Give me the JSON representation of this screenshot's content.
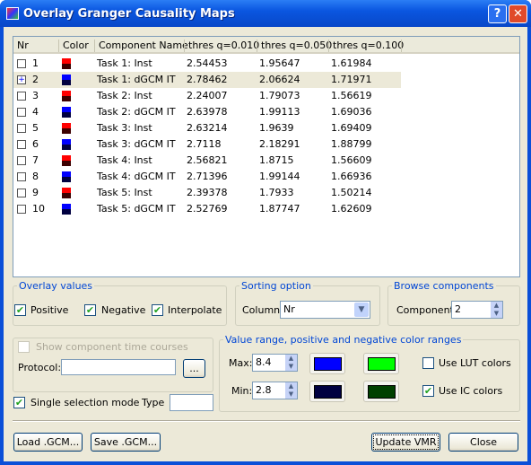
{
  "window": {
    "title": "Overlay Granger Causality Maps",
    "help": "?",
    "close": "✕"
  },
  "table": {
    "headers": [
      "Nr",
      "Color",
      "Component Name",
      "thres q=0.010",
      "thres q=0.050",
      "thres q=0.100"
    ],
    "rows": [
      {
        "nr": "1",
        "name": "Task 1: Inst",
        "t1": "2.54453",
        "t2": "1.95647",
        "t3": "1.61984",
        "type": "inst",
        "expanded": false
      },
      {
        "nr": "2",
        "name": "Task 1: dGCM IT",
        "t1": "2.78462",
        "t2": "2.06624",
        "t3": "1.71971",
        "type": "dgcm",
        "expanded": true
      },
      {
        "nr": "3",
        "name": "Task 2: Inst",
        "t1": "2.24007",
        "t2": "1.79073",
        "t3": "1.56619",
        "type": "inst",
        "expanded": false
      },
      {
        "nr": "4",
        "name": "Task 2: dGCM IT",
        "t1": "2.63978",
        "t2": "1.99113",
        "t3": "1.69036",
        "type": "dgcm",
        "expanded": false
      },
      {
        "nr": "5",
        "name": "Task 3: Inst",
        "t1": "2.63214",
        "t2": "1.9639",
        "t3": "1.69409",
        "type": "inst",
        "expanded": false
      },
      {
        "nr": "6",
        "name": "Task 3: dGCM IT",
        "t1": "2.7118",
        "t2": "2.18291",
        "t3": "1.88799",
        "type": "dgcm",
        "expanded": false
      },
      {
        "nr": "7",
        "name": "Task 4: Inst",
        "t1": "2.56821",
        "t2": "1.8715",
        "t3": "1.56609",
        "type": "inst",
        "expanded": false
      },
      {
        "nr": "8",
        "name": "Task 4: dGCM IT",
        "t1": "2.71396",
        "t2": "1.99144",
        "t3": "1.66936",
        "type": "dgcm",
        "expanded": false
      },
      {
        "nr": "9",
        "name": "Task 5: Inst",
        "t1": "2.39378",
        "t2": "1.7933",
        "t3": "1.50214",
        "type": "inst",
        "expanded": false
      },
      {
        "nr": "10",
        "name": "Task 5: dGCM IT",
        "t1": "2.52769",
        "t2": "1.87747",
        "t3": "1.62609",
        "type": "dgcm",
        "expanded": false
      }
    ],
    "selected_row": "2",
    "swatch_colors": {
      "inst": [
        "#ff0000",
        "#3c0000"
      ],
      "dgcm": [
        "#0000ff",
        "#000040"
      ]
    }
  },
  "overlay": {
    "legend": "Overlay values",
    "positive": "Positive",
    "negative": "Negative",
    "interpolate": "Interpolate"
  },
  "sorting": {
    "legend": "Sorting option",
    "label": "Column:",
    "value": "Nr"
  },
  "browse": {
    "legend": "Browse components",
    "label": "Component:",
    "value": "2"
  },
  "timecourse": {
    "show_label": "Show component time courses",
    "protocol_label": "Protocol:",
    "protocol_value": "",
    "browse_label": "..."
  },
  "single_selection": {
    "label": "Single selection mode",
    "checked": true,
    "type_label": "Type",
    "type_value": ""
  },
  "range": {
    "legend": "Value range, positive and negative color ranges",
    "max_label": "Max:",
    "max_value": "8.4",
    "min_label": "Min:",
    "min_value": "2.8",
    "colors": {
      "pos_max": "#0000ff",
      "neg_max": "#00ff00",
      "pos_min": "#000040",
      "neg_min": "#004000"
    },
    "use_lut": "Use LUT colors",
    "use_ic": "Use IC colors"
  },
  "buttons": {
    "load": "Load .GCM...",
    "save": "Save .GCM...",
    "update": "Update VMR",
    "close": "Close"
  }
}
